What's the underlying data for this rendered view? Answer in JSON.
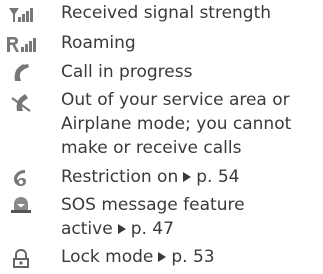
{
  "items": [
    {
      "icon": "signal-strength-icon",
      "lines": [
        "Received signal strength"
      ]
    },
    {
      "icon": "roaming-icon",
      "lines": [
        "Roaming"
      ]
    },
    {
      "icon": "call-in-progress-icon",
      "lines": [
        "Call in progress"
      ]
    },
    {
      "icon": "no-service-icon",
      "lines": [
        "Out of your service area or",
        "Airplane mode; you cannot",
        "make or receive calls"
      ]
    },
    {
      "icon": "restriction-icon",
      "text": "Restriction on",
      "ref": "p. 54"
    },
    {
      "icon": "sos-message-icon",
      "lines": [
        "SOS message feature"
      ],
      "last_text": "active",
      "ref": "p. 47"
    },
    {
      "icon": "lock-mode-icon",
      "text": "Lock mode",
      "ref": "p. 53"
    }
  ]
}
